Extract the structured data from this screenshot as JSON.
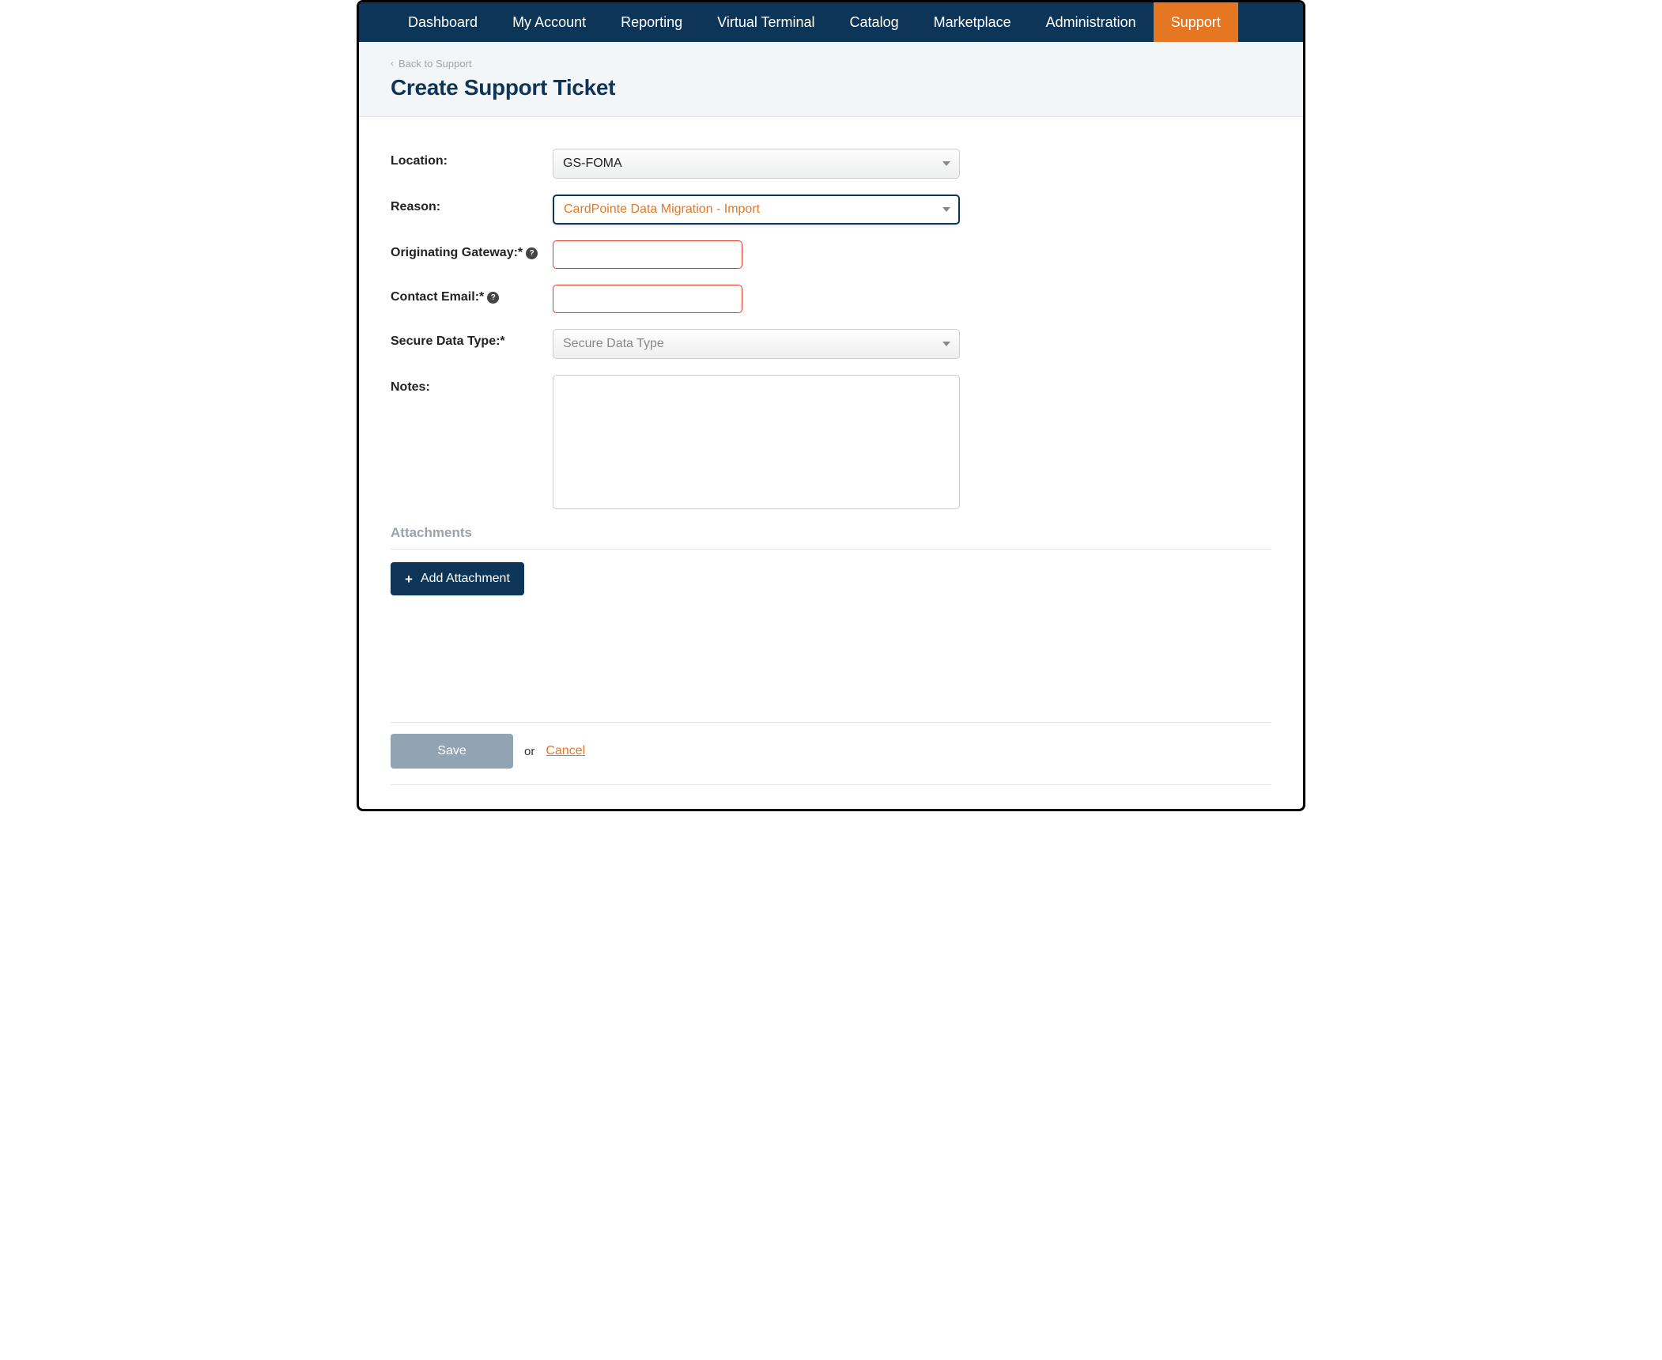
{
  "nav": {
    "items": [
      {
        "label": "Dashboard",
        "active": false
      },
      {
        "label": "My Account",
        "active": false
      },
      {
        "label": "Reporting",
        "active": false
      },
      {
        "label": "Virtual Terminal",
        "active": false
      },
      {
        "label": "Catalog",
        "active": false
      },
      {
        "label": "Marketplace",
        "active": false
      },
      {
        "label": "Administration",
        "active": false
      },
      {
        "label": "Support",
        "active": true
      }
    ]
  },
  "header": {
    "back_label": "Back to Support",
    "page_title": "Create Support Ticket"
  },
  "form": {
    "location": {
      "label": "Location:",
      "value": "GS-FOMA"
    },
    "reason": {
      "label": "Reason:",
      "value": "CardPointe Data Migration - Import"
    },
    "originating_gateway": {
      "label": "Originating Gateway:*",
      "value": ""
    },
    "contact_email": {
      "label": "Contact Email:*",
      "value": ""
    },
    "secure_data_type": {
      "label": "Secure Data Type:*",
      "placeholder": "Secure Data Type"
    },
    "notes": {
      "label": "Notes:",
      "value": ""
    }
  },
  "attachments": {
    "heading": "Attachments",
    "add_button": "Add Attachment"
  },
  "actions": {
    "save": "Save",
    "or": "or",
    "cancel": "Cancel"
  }
}
